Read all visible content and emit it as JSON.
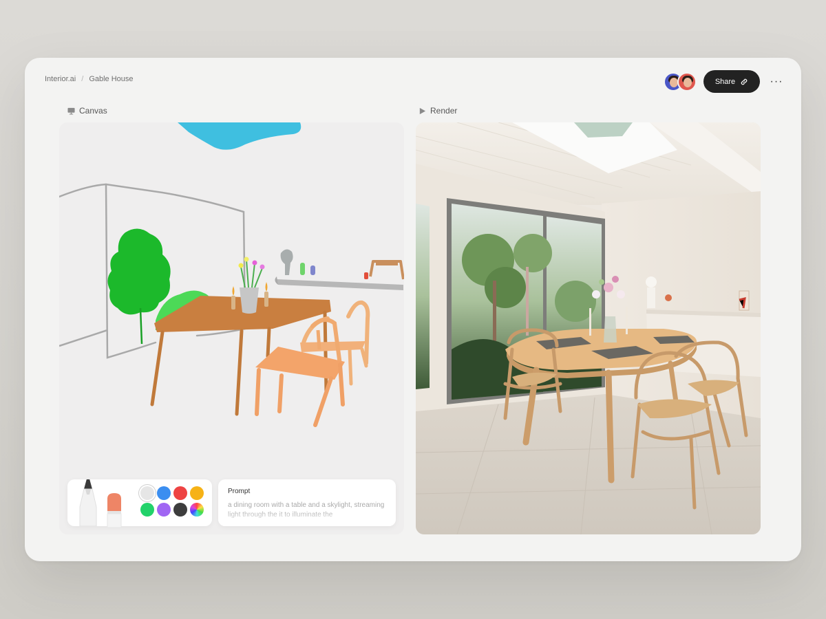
{
  "breadcrumb": {
    "app": "Interior.ai",
    "separator": "/",
    "project": "Gable House"
  },
  "header": {
    "share_label": "Share",
    "more_label": "···",
    "share_icon": "link-icon",
    "more_icon": "more-icon"
  },
  "avatars": [
    {
      "name": "collaborator-1"
    },
    {
      "name": "collaborator-2"
    }
  ],
  "canvas": {
    "label": "Canvas",
    "icon": "easel-icon"
  },
  "render": {
    "label": "Render",
    "icon": "play-icon"
  },
  "tools": {
    "pencil": "pencil-icon",
    "eraser": "eraser-icon"
  },
  "palette": {
    "colors": [
      "#e6e6e6",
      "#3b8ef0",
      "#ee4343",
      "#f6b216",
      "#22d26a",
      "#a066f3",
      "#3d3d3d",
      "conic"
    ],
    "selected_index": 0
  },
  "prompt": {
    "title": "Prompt",
    "text": "a dining room with a table and a skylight, streaming light through the it to illuminate the"
  }
}
